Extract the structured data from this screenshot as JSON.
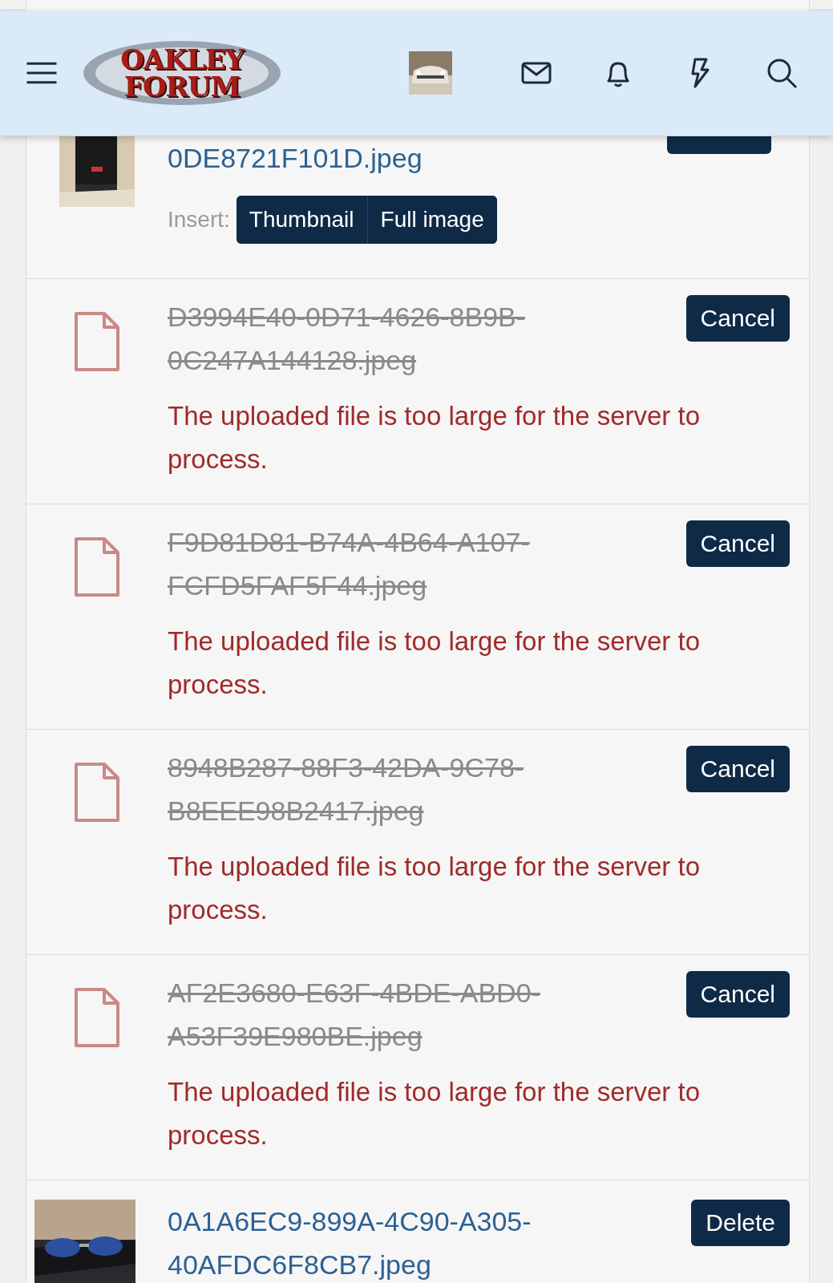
{
  "header": {
    "logo": {
      "line_1": "OAKLEY",
      "line_2": "FORUM"
    }
  },
  "attachments": [
    {
      "kind": "partial_image",
      "name": "0DE8721F101D.jpeg",
      "insert_label": "Insert:",
      "insert_buttons": [
        "Thumbnail",
        "Full image"
      ]
    },
    {
      "kind": "failed",
      "name": "D3994E40-0D71-4626-8B9B-0C247A144128.jpeg",
      "action": "Cancel",
      "error": "The uploaded file is too large for the server to process."
    },
    {
      "kind": "failed",
      "name": "F9D81D81-B74A-4B64-A107-FCFD5FAF5F44.jpeg",
      "action": "Cancel",
      "error": "The uploaded file is too large for the server to process."
    },
    {
      "kind": "failed",
      "name": "8948B287-88F3-42DA-9C78-B8EEE98B2417.jpeg",
      "action": "Cancel",
      "error": "The uploaded file is too large for the server to process."
    },
    {
      "kind": "failed",
      "name": "AF2E3680-E63F-4BDE-ABD0-A53F39E980BE.jpeg",
      "action": "Cancel",
      "error": "The uploaded file is too large for the server to process."
    },
    {
      "name": "0A1A6EC9-899A-4C90-A305-40AFDC6F8CB7.jpeg",
      "action": "Delete"
    }
  ]
}
